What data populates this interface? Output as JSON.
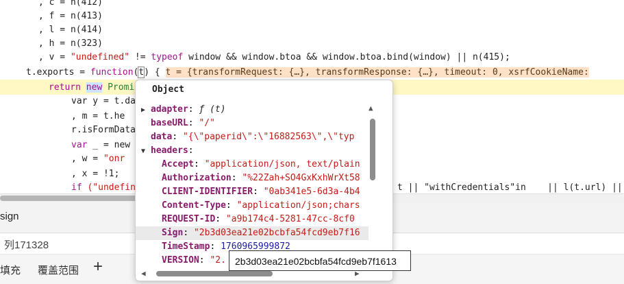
{
  "code": {
    "l1_comma": ", ",
    "l1_var": "c",
    "l1_rest": " = n(412)",
    "l2": [
      ", ",
      "f",
      " = n(413)"
    ],
    "l3": [
      ", ",
      "l",
      " = n(414)"
    ],
    "l4": [
      ", ",
      "h",
      " = n(323)"
    ],
    "l5_a": ", ",
    "l5_v": "v",
    "l5_eq": " = ",
    "l5_str": "\"undefined\"",
    "l5_ne": " != ",
    "l5_typeof": "typeof",
    "l5_rest": " window && window.btoa && window.btoa.bind(window) || n(415);",
    "l6_a": "t.exports = ",
    "l6_fn": "function",
    "l6_paren_open": "(",
    "l6_t": "t",
    "l6_paren_close": ") {",
    "l6_inline": "t = {transformRequest: {…}, transformResponse: {…}, timeout: 0, xsrfCookieName:",
    "l7_return": "return",
    "l7_new": "new",
    "l7_rest": " Promi",
    "l8": "var y = t.da",
    "l9": ", m = t.he",
    "l10": "r.isFormData",
    "l11_var": "var",
    "l11_rest": " _ = new",
    "l12_a": ", w = ",
    "l12_str": "\"onr",
    "l13": ", x = !1;",
    "l14_if": "if",
    "l14_str": "(\"undefin",
    "l14_right": "t || \"withCredentials\"in    || l(t.url) ||"
  },
  "sheet": {
    "name_label": "sign",
    "column_label": "列171328",
    "fill_label": "填充",
    "coverage_label": "覆盖范围",
    "add_label": "+"
  },
  "popup": {
    "title": "Object",
    "props": [
      {
        "key": "adapter",
        "sep": ": ",
        "val": "ƒ (t)",
        "type": "fn",
        "expand": "collapsed",
        "indent": 0
      },
      {
        "key": "baseURL",
        "sep": ": ",
        "val": "\"/\"",
        "type": "str",
        "expand": "none",
        "indent": 0
      },
      {
        "key": "data",
        "sep": ": ",
        "val": "\"{\\\"paperid\\\":\\\"16882563\\\",\\\"typ",
        "type": "str",
        "expand": "none",
        "indent": 0
      },
      {
        "key": "headers",
        "sep": ":",
        "val": "",
        "type": "str",
        "expand": "expanded",
        "indent": 0
      },
      {
        "key": "Accept",
        "sep": ": ",
        "val": "\"application/json, text/plain",
        "type": "str",
        "expand": "none",
        "indent": 1
      },
      {
        "key": "Authorization",
        "sep": ": ",
        "val": "\"%22Zah+SO4GxKxhWrXt58",
        "type": "str",
        "expand": "none",
        "indent": 1
      },
      {
        "key": "CLIENT-IDENTIFIER",
        "sep": ": ",
        "val": "\"0ab341e5-6d3a-4b4",
        "type": "str",
        "expand": "none",
        "indent": 1
      },
      {
        "key": "Content-Type",
        "sep": ": ",
        "val": "\"application/json;chars",
        "type": "str",
        "expand": "none",
        "indent": 1
      },
      {
        "key": "REQUEST-ID",
        "sep": ": ",
        "val": "\"a9b174c4-5281-47cc-8cf0",
        "type": "str",
        "expand": "none",
        "indent": 1
      },
      {
        "key": "Sign",
        "sep": ": ",
        "val": "\"2b3d03ea21e02bcbfa54fcd9eb7f16",
        "type": "str",
        "expand": "none",
        "indent": 1,
        "selected": true
      },
      {
        "key": "TimeStamp",
        "sep": ": ",
        "val": "1760965999872",
        "type": "num",
        "expand": "none",
        "indent": 1
      },
      {
        "key": "VERSION",
        "sep": ": ",
        "val": "\"2.",
        "type": "str",
        "expand": "none",
        "indent": 1
      }
    ]
  },
  "tooltip": {
    "text": "2b3d03ea21e02bcbfa54fcd9eb7f1613"
  },
  "icons": {
    "tri_right": "▶",
    "tri_down": "▼",
    "arrow_up": "▲",
    "arrow_down": "▼",
    "arrow_left": "◀",
    "arrow_right": "▶"
  }
}
